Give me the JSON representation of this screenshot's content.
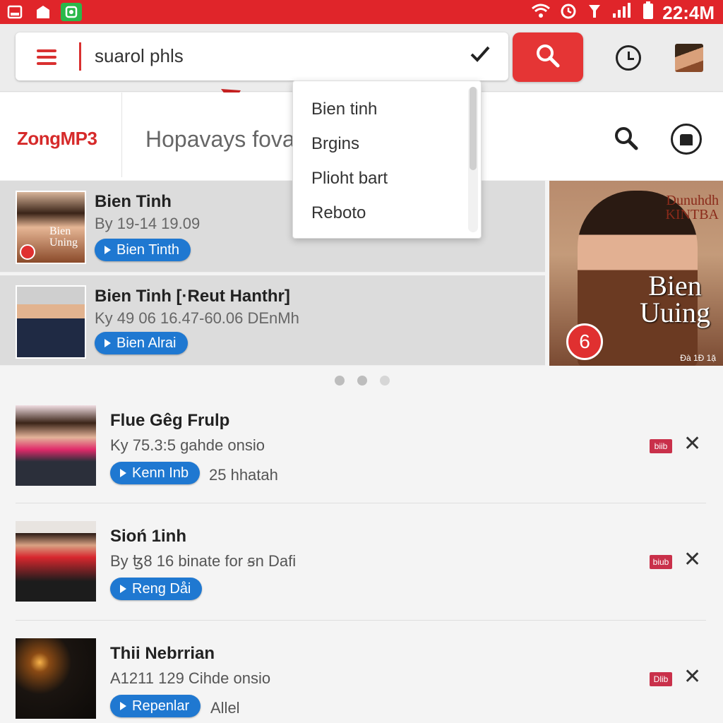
{
  "status_bar": {
    "time": "22:4M",
    "colors": {
      "bar": "#e0252a",
      "app_icon_green": "#2ab84a"
    },
    "icons": [
      "notification-icon",
      "photo-icon",
      "app-icon",
      "wifi-icon",
      "alarm-icon",
      "signal-icon",
      "battery-icon"
    ]
  },
  "search": {
    "value": "suarol phls"
  },
  "brand": {
    "logo": "ZongMP3",
    "title": "Hopavays fova",
    "accent": "#d62a2a"
  },
  "dropdown": {
    "items": [
      "Bien tinh",
      "Brgins",
      "Plioht bart",
      "Reboto"
    ]
  },
  "featured": [
    {
      "title": "Bien Tinh",
      "subtitle": "By 19-14 19.09",
      "button": "Bien Tinth",
      "thumb_text": "Bien Uning"
    },
    {
      "title": "Bien Tinh [·Reut Hanthr]",
      "subtitle": "Ky 49 06 16.47-60.06 DEnMh",
      "button": "Bien Alrai"
    }
  ],
  "featured_banner": {
    "top_text": "Dunuhdh KINTBA",
    "title": "Bien Uuing",
    "badge": "6",
    "footer": "Đà 1Đ 1ặ"
  },
  "carousel": {
    "dot_count": 3
  },
  "list": [
    {
      "title": "Flue Gêg Frulp",
      "subtitle": "Ky 75.3:5 gahde onsio",
      "button": "Kenn Inb",
      "extra": "25 hhatah",
      "tag": "biib"
    },
    {
      "title": "Sioń 1inh",
      "subtitle": "By ꜩ8 16 binate for ꞩn Dafi",
      "button": "Reng Dåi",
      "extra": "",
      "tag": "biub"
    },
    {
      "title": "Thii Nebrrian",
      "subtitle": "A1211 129 Cihde onsio",
      "button": "Repenlar",
      "extra": "Allel",
      "tag": "Dlib"
    }
  ],
  "theme": {
    "primary_red": "#e53535",
    "button_blue": "#1f78d1",
    "tag_red": "#c9304a"
  }
}
